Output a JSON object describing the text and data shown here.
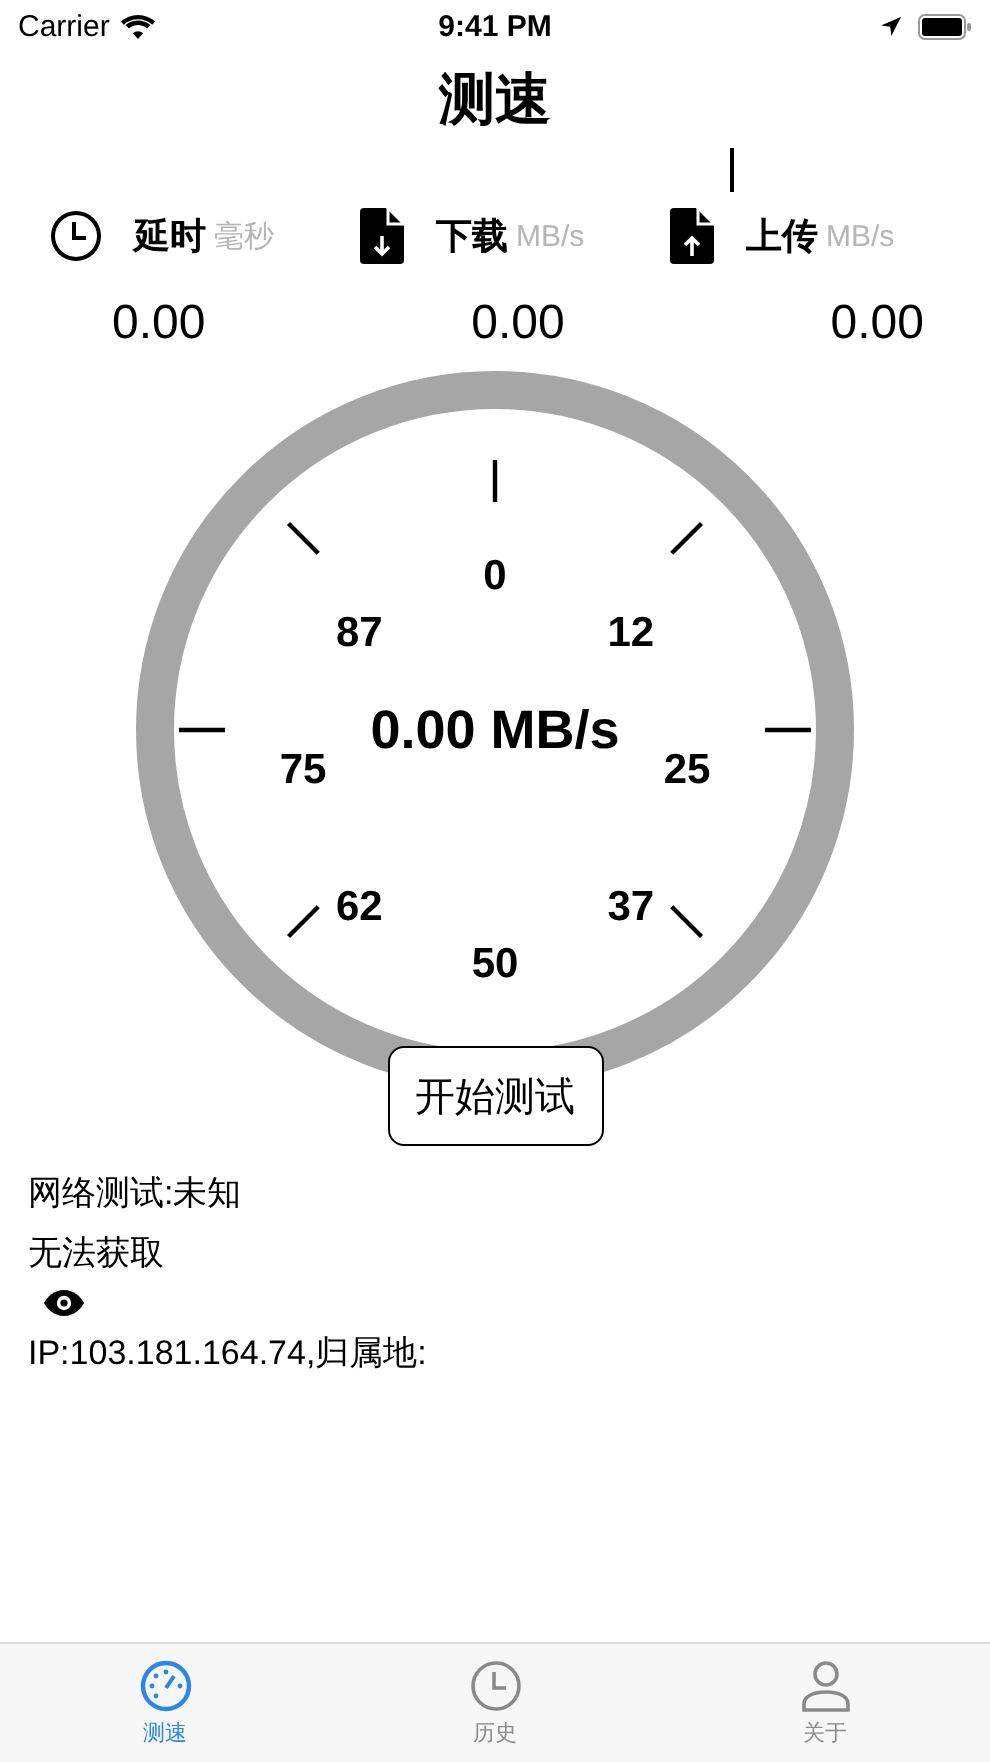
{
  "status_bar": {
    "carrier": "Carrier",
    "time": "9:41 PM"
  },
  "title": "测速",
  "metrics": [
    {
      "kind": "latency",
      "label": "延时",
      "unit": "毫秒",
      "value": "0.00"
    },
    {
      "kind": "download",
      "label": "下载",
      "unit": "MB/s",
      "value": "0.00"
    },
    {
      "kind": "upload",
      "label": "上传",
      "unit": "MB/s",
      "value": "0.00"
    }
  ],
  "gauge": {
    "reading": "0.00 MB/s",
    "scale_labels": [
      "0",
      "12",
      "25",
      "37",
      "50",
      "62",
      "75",
      "87"
    ]
  },
  "start_button": "开始测试",
  "info": {
    "network_test": "网络测试:未知",
    "status": "无法获取",
    "ip": "IP:103.181.164.74,归属地:"
  },
  "tab_bar": [
    {
      "kind": "speed",
      "label": "测速",
      "selected": true
    },
    {
      "kind": "history",
      "label": "历史",
      "selected": false
    },
    {
      "kind": "about",
      "label": "关于",
      "selected": false
    }
  ]
}
